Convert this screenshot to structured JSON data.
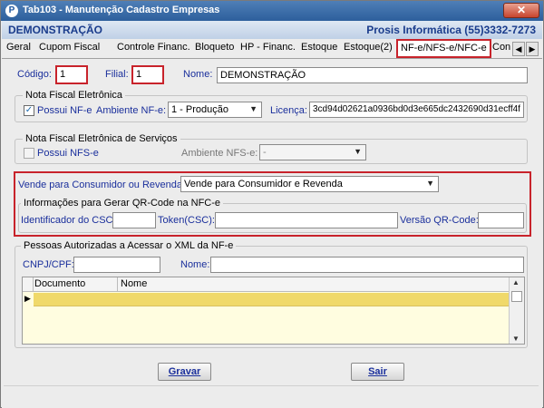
{
  "window": {
    "title": "Tab103 - Manutenção Cadastro Empresas",
    "app_icon": "P",
    "close_label": "✕"
  },
  "header": {
    "company_left": "DEMONSTRAÇÃO",
    "company_right": "Prosis Informática (55)3332-7273"
  },
  "tabs": [
    {
      "label": "Geral"
    },
    {
      "label": "Cupom Fiscal"
    },
    {
      "label": "Controle Financ."
    },
    {
      "label": "Bloqueto"
    },
    {
      "label": "HP - Financ."
    },
    {
      "label": "Estoque"
    },
    {
      "label": "Estoque(2)"
    },
    {
      "label": "NF-e/NFS-e/NFC-e"
    },
    {
      "label": "Con"
    }
  ],
  "tab_scroll": {
    "left": "◀",
    "right": "▶"
  },
  "ident": {
    "codigo_label": "Código:",
    "codigo_value": "1",
    "filial_label": "Filial:",
    "filial_value": "1",
    "nome_label": "Nome:",
    "nome_value": "DEMONSTRAÇÃO"
  },
  "nfe": {
    "group_title": "Nota Fiscal Eletrônica",
    "possui_label": "Possui NF-e",
    "possui_checked": "✓",
    "ambiente_label": "Ambiente NF-e:",
    "ambiente_value": "1 - Produção",
    "licenca_label": "Licença:",
    "licenca_value": "3cd94d02621a0936bd0d3e665dc2432690d31ecff4f"
  },
  "nfse": {
    "group_title": "Nota Fiscal Eletrônica de Serviços",
    "possui_label": "Possui NFS-e",
    "ambiente_label": "Ambiente NFS-e:",
    "ambiente_value": "-"
  },
  "nfce": {
    "vende_label": "Vende para Consumidor ou Revenda:",
    "vende_value": "Vende para Consumidor e Revenda",
    "qr_group_title": "Informações para Gerar QR-Code na NFC-e",
    "csc_id_label": "Identificador do CSC:",
    "csc_id_value": "",
    "token_label": "Token(CSC):",
    "token_value": "",
    "versao_label": "Versão QR-Code:",
    "versao_value": ""
  },
  "xml_access": {
    "group_title": "Pessoas Autorizadas a Acessar o XML da NF-e",
    "cnpj_label": "CNPJ/CPF:",
    "cnpj_value": "",
    "nome_label": "Nome:",
    "nome_value": "",
    "columns": [
      "Documento",
      "Nome"
    ],
    "row_indicator": "▶",
    "scroll_up": "▲",
    "scroll_down": "▼"
  },
  "actions": {
    "gravar_label": "Gravar",
    "sair_label": "Sair"
  },
  "colors": {
    "accent_red": "#c8232b",
    "label_blue": "#1a2f9c",
    "grid_selected": "#f0d96a"
  }
}
